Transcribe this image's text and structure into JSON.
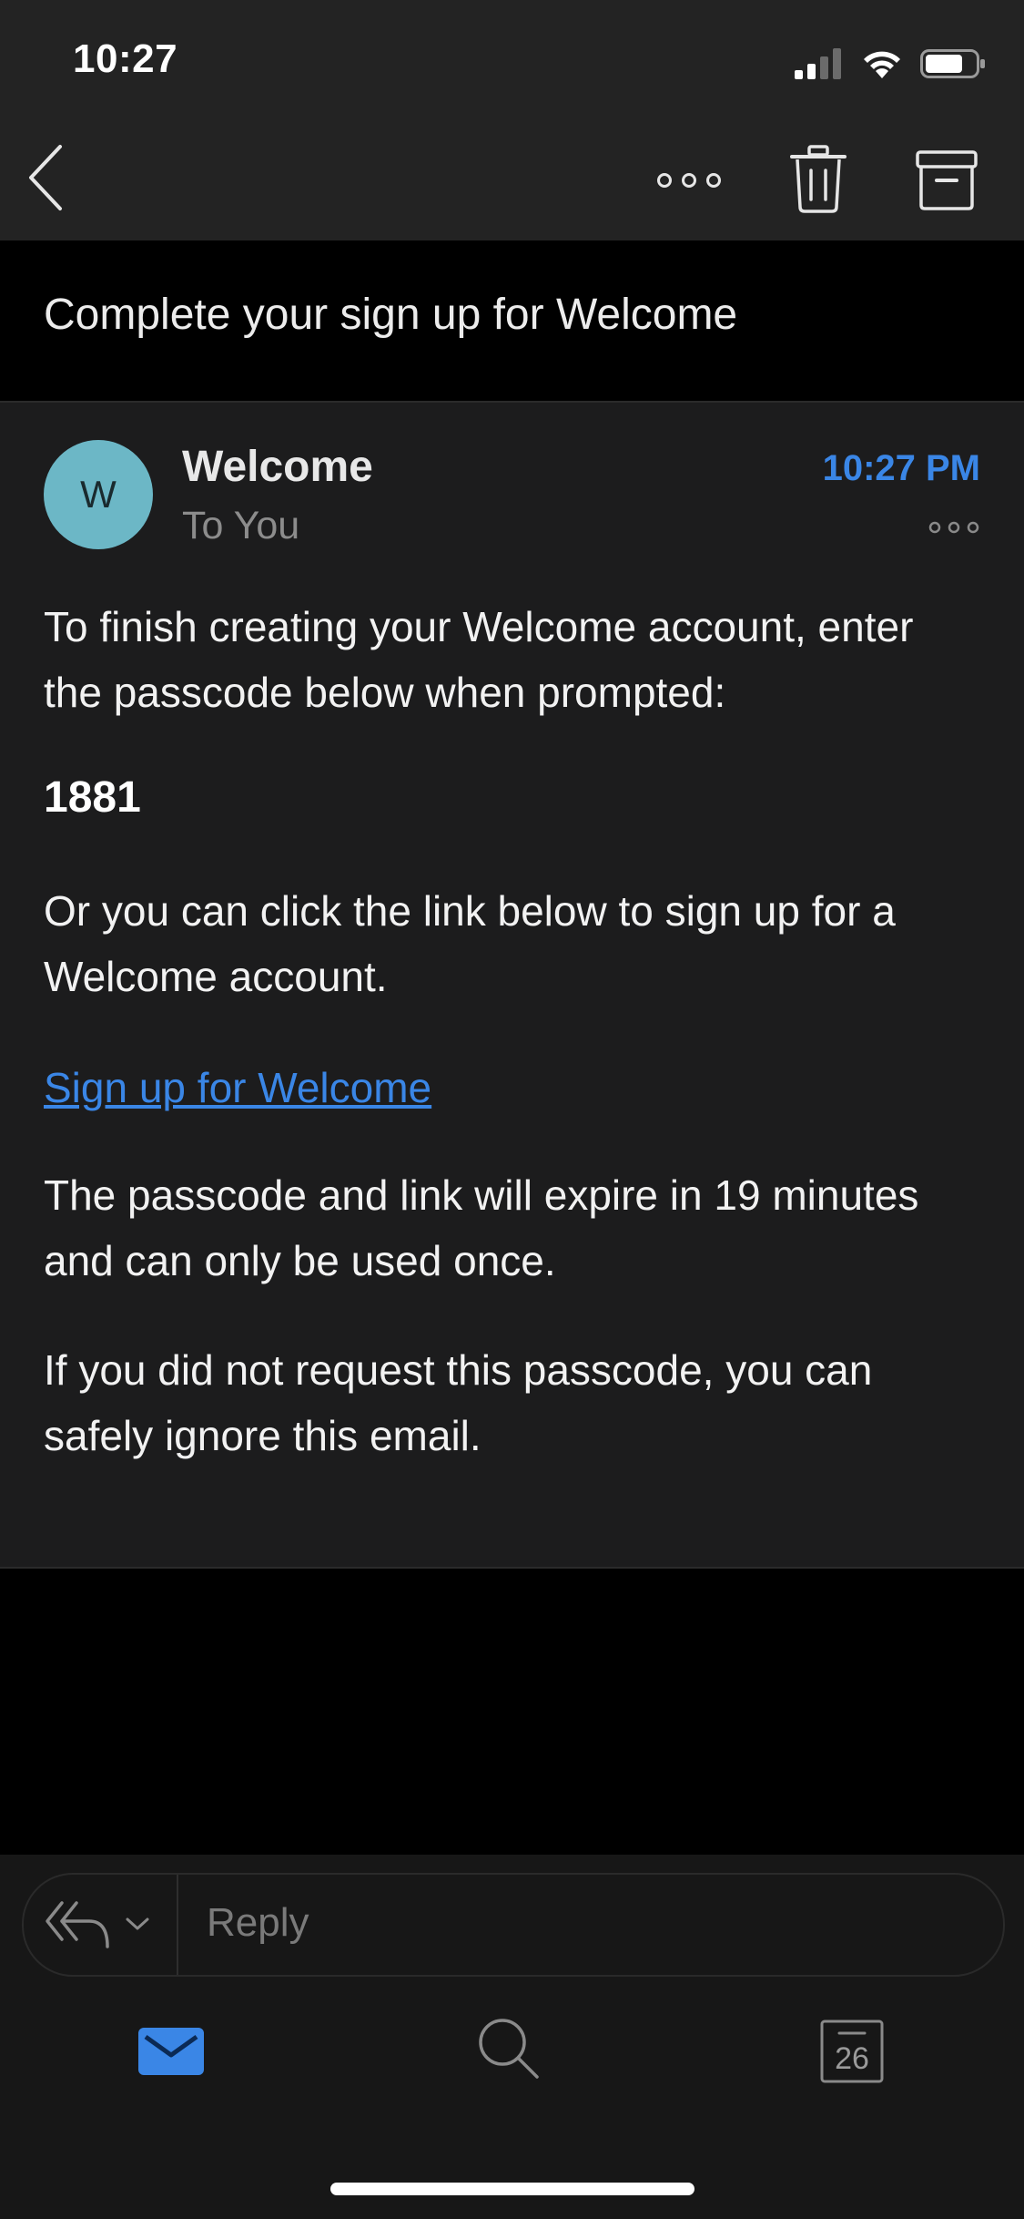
{
  "status_bar": {
    "time": "10:27"
  },
  "toolbar": {
    "back_icon": "chevron-left-icon",
    "more_icon": "more-horizontal-icon",
    "delete_icon": "trash-icon",
    "archive_icon": "archive-icon"
  },
  "email": {
    "subject": "Complete your sign up for Welcome",
    "sender_initial": "W",
    "sender_name": "Welcome",
    "recipient": "To You",
    "sent_time": "10:27 PM",
    "paragraph_1": "To finish creating your Welcome account, enter the passcode below when prompted:",
    "passcode": "1881",
    "paragraph_2": "Or you can click the link below to sign up for a Welcome account.",
    "link_text": "Sign up for Welcome",
    "paragraph_3": "The passcode and link will expire in 19 minutes and can only be used once.",
    "paragraph_4": "If you did not request this passcode, you can safely ignore this email."
  },
  "reply": {
    "placeholder": "Reply"
  },
  "tab_bar": {
    "calendar_day": "26"
  },
  "colors": {
    "accent": "#3a86e6",
    "avatar": "#6cb7c6",
    "toolbar_bg": "#232323",
    "card_bg": "#1c1c1d"
  }
}
